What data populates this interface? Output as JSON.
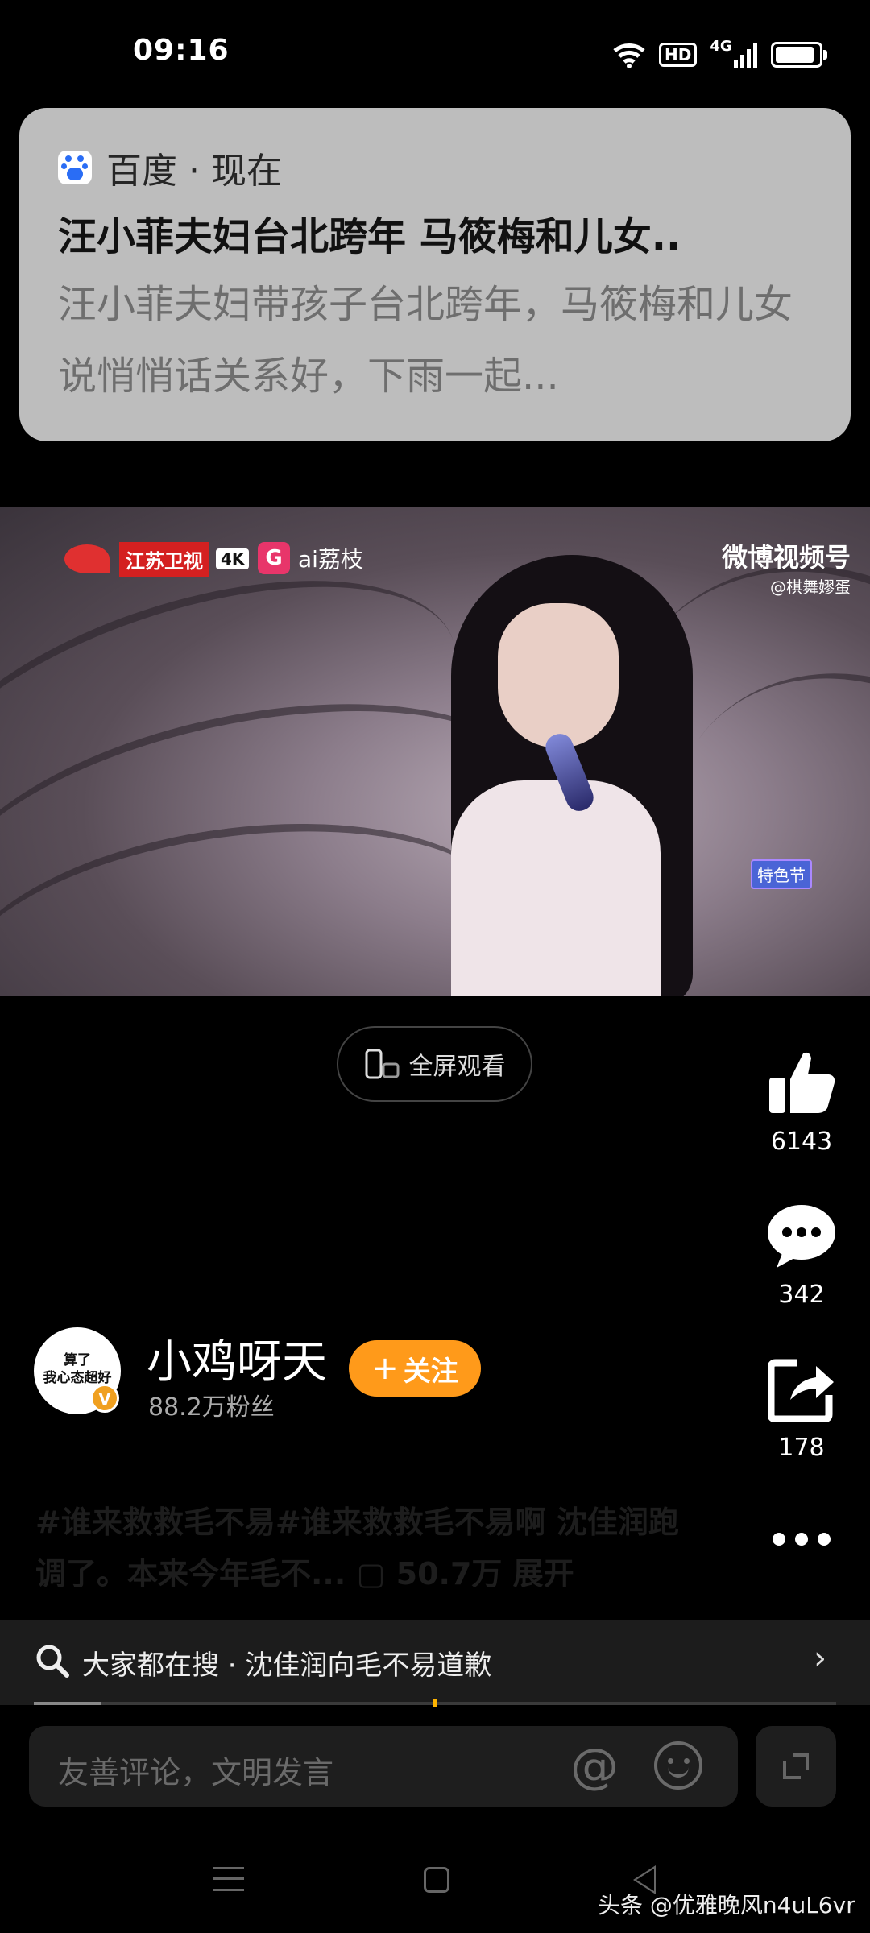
{
  "status_bar": {
    "time": "09:16",
    "network_label": "4G",
    "hd_label": "HD",
    "battery_level": 0.9,
    "icons": [
      "wifi-icon",
      "hd-icon",
      "signal-icon",
      "battery-icon"
    ]
  },
  "notification": {
    "app_name": "百度 · 现在",
    "title": "汪小菲夫妇台北跨年 马筱梅和儿女..",
    "body": "汪小菲夫妇带孩子台北跨年，马筱梅和儿女说悄悄话关系好，下雨一起..."
  },
  "video": {
    "channel_logo": "江苏卫视",
    "channel_4k": "4K",
    "streamer_logo": "ai荔枝",
    "watermark_line1": "微博视频号",
    "watermark_line2": "@棋舞嫪蛋",
    "show_badge": "特色节"
  },
  "fullscreen_label": "全屏观看",
  "actions": {
    "likes": "6143",
    "comments": "342",
    "shares": "178"
  },
  "author": {
    "avatar_text": "算了\n我心态超好",
    "badge": "V",
    "name": "小鸡呀天",
    "fans": "88.2万粉丝",
    "follow_label": "关注"
  },
  "caption": "#谁来救救毛不易#谁来救救毛不易啊 沈佳润跑调了。本来今年毛不... ▢ 50.7万 展开",
  "search": {
    "text": "大家都在搜 · 沈佳润向毛不易道歉"
  },
  "progress": {
    "played_fraction": 0.084
  },
  "comment_bar": {
    "placeholder": "友善评论，文明发言"
  },
  "footer_watermark": "头条 @优雅晚风n4uL6vr",
  "colors": {
    "accent": "#ff9a1a",
    "background": "#000000",
    "notification_bg": "#bdbdbd"
  }
}
